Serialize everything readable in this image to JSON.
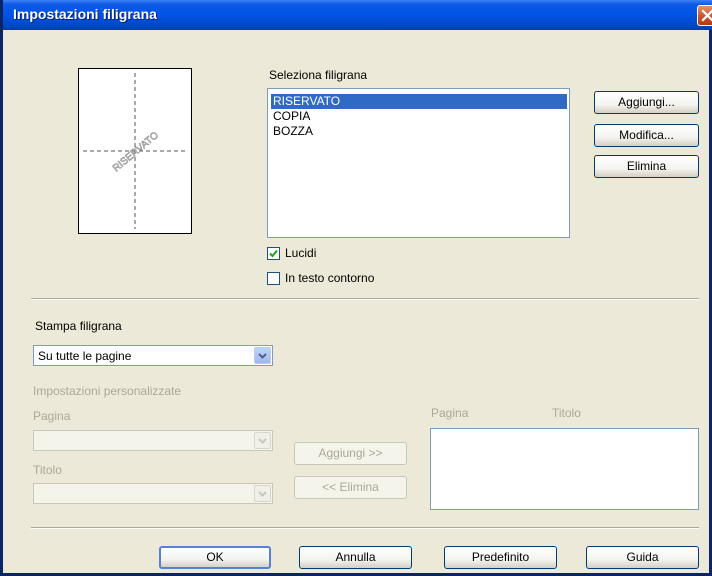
{
  "window": {
    "title": "Impostazioni filigrana"
  },
  "preview": {
    "watermark_text": "RISERVATO"
  },
  "select_watermark": {
    "label": "Seleziona filigrana",
    "items": [
      "RISERVATO",
      "COPIA",
      "BOZZA"
    ],
    "selected": "RISERVATO"
  },
  "side_buttons": {
    "add": "Aggiungi...",
    "edit": "Modifica...",
    "delete": "Elimina"
  },
  "options": {
    "transparent": {
      "label": "Lucidi",
      "checked": true
    },
    "outline": {
      "label": "In testo contorno",
      "checked": false
    }
  },
  "print_watermark": {
    "label": "Stampa filigrana",
    "value": "Su tutte le pagine"
  },
  "custom": {
    "label": "Impostazioni personalizzate",
    "page_label": "Pagina",
    "title_label": "Titolo",
    "add_button": "Aggiungi >>",
    "remove_button": "<< Elimina",
    "list_header_page": "Pagina",
    "list_header_title": "Titolo"
  },
  "footer": {
    "ok": "OK",
    "cancel": "Annulla",
    "default": "Predefinito",
    "help": "Guida"
  },
  "colors": {
    "titlebar": "#0054E3",
    "dialog_bg": "#ECE9D8",
    "selection": "#316AC5"
  }
}
